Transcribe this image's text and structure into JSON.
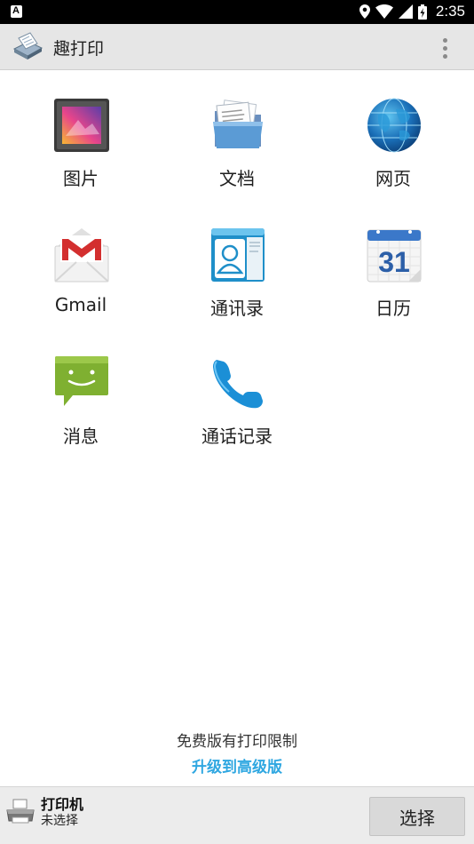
{
  "status_bar": {
    "time": "2:35",
    "left_glyph": "A"
  },
  "app_bar": {
    "title": "趣打印"
  },
  "tiles": [
    {
      "label": "图片"
    },
    {
      "label": "文档"
    },
    {
      "label": "网页"
    },
    {
      "label": "Gmail"
    },
    {
      "label": "通讯录"
    },
    {
      "label": "日历"
    },
    {
      "label": "消息"
    },
    {
      "label": "通话记录"
    }
  ],
  "calendar_day": "31",
  "promo": {
    "text": "免费版有打印限制",
    "link": "升级到高级版"
  },
  "bottom": {
    "printer_label": "打印机",
    "printer_status": "未选择",
    "select_button": "选择"
  },
  "colors": {
    "accent": "#2fa7e1",
    "app_bar": "#e6e6e6",
    "bottom_bar": "#ececec"
  }
}
